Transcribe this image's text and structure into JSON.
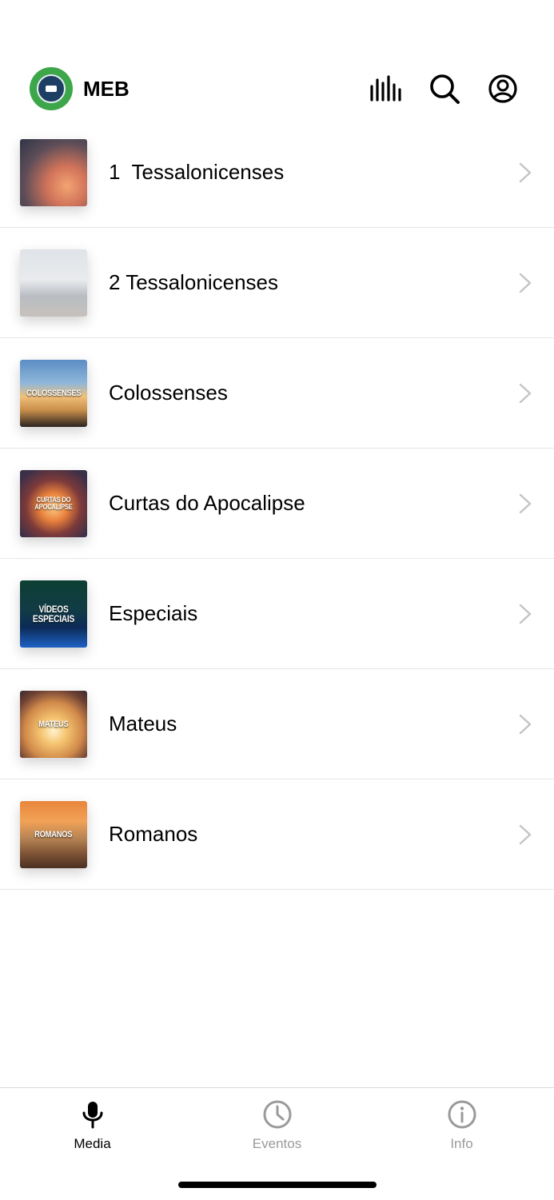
{
  "header": {
    "title": "MEB",
    "icons": [
      "equalizer-icon",
      "search-icon",
      "account-icon"
    ]
  },
  "series_list": [
    {
      "label": "1  Tessalonicenses",
      "thumb_text": ""
    },
    {
      "label": "2 Tessalonicenses",
      "thumb_text": ""
    },
    {
      "label": "Colossenses",
      "thumb_text": "COLOSSENSES"
    },
    {
      "label": "Curtas do Apocalipse",
      "thumb_text": "CURTAS DO APOCALIPSE"
    },
    {
      "label": "Especiais",
      "thumb_text": "VÍDEOS ESPECIAIS"
    },
    {
      "label": "Mateus",
      "thumb_text": "MATEUS"
    },
    {
      "label": "Romanos",
      "thumb_text": "ROMANOS"
    }
  ],
  "tabs": [
    {
      "label": "Media",
      "icon": "microphone-icon",
      "active": true
    },
    {
      "label": "Eventos",
      "icon": "clock-icon",
      "active": false
    },
    {
      "label": "Info",
      "icon": "info-icon",
      "active": false
    }
  ],
  "colors": {
    "brand_green": "#3ea64a",
    "inactive_gray": "#9a9a9a",
    "divider": "#e6e6e6"
  }
}
